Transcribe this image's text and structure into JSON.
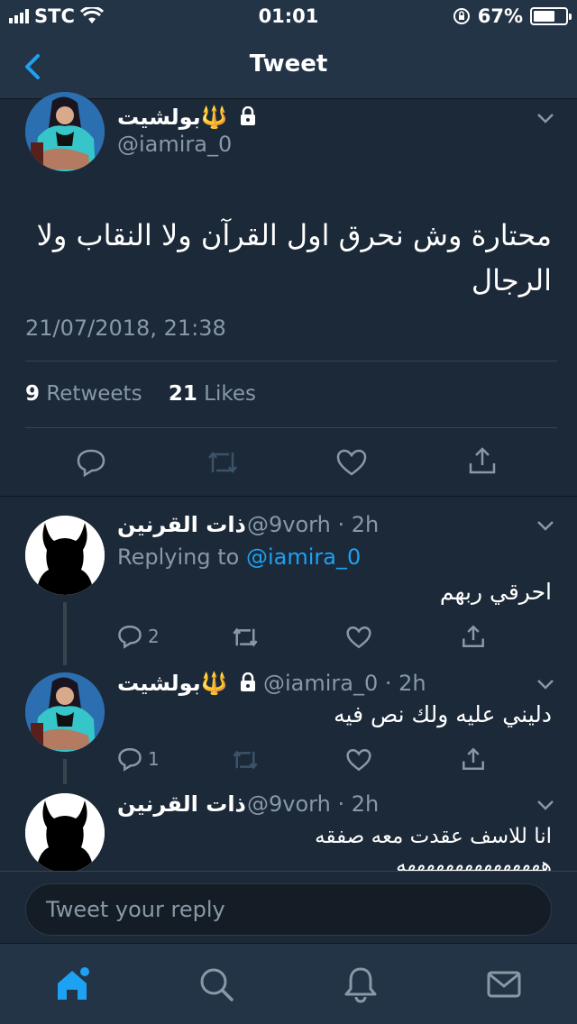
{
  "status_bar": {
    "carrier": "STC",
    "time": "01:01",
    "battery": "67%",
    "battery_level": 0.67
  },
  "nav": {
    "title": "Tweet"
  },
  "main_tweet": {
    "name": "بولشيت🔱",
    "handle": "@iamira_0",
    "text_line1": "محتارة وش نحرق اول القرآن ولا النقاب ولا",
    "text_line2": "الرجال",
    "timestamp": "21/07/2018, 21:38",
    "retweets_count": "9",
    "retweets_label": "Retweets",
    "likes_count": "21",
    "likes_label": "Likes"
  },
  "replies": [
    {
      "name": "ذات القرنين",
      "handle": "@9vorh · 2h",
      "replying_prefix": "Replying to",
      "replying_to": "@iamira_0",
      "text": "احرقي ربهم",
      "reply_count": "2"
    },
    {
      "name": "بولشيت🔱",
      "handle": "@iamira_0 · 2h",
      "text": "دليني عليه ولك نص فيه",
      "reply_count": "1"
    },
    {
      "name": "ذات القرنين",
      "handle": "@9vorh · 2h",
      "text_line1": "انا للاسف عقدت معه صفقه",
      "text_line2": "هههههههههههههههه"
    }
  ],
  "composer": {
    "placeholder": "Tweet your reply"
  },
  "icons": [
    "back-chevron-icon",
    "lock-icon",
    "chevron-down-icon",
    "reply-icon",
    "retweet-icon",
    "like-icon",
    "share-icon",
    "home-icon",
    "search-icon",
    "notifications-icon",
    "messages-icon"
  ],
  "colors": {
    "background": "#1c2938",
    "bar": "#243447",
    "accent": "#1da1f2",
    "secondary_text": "#8899a6",
    "divider": "#38444d"
  }
}
